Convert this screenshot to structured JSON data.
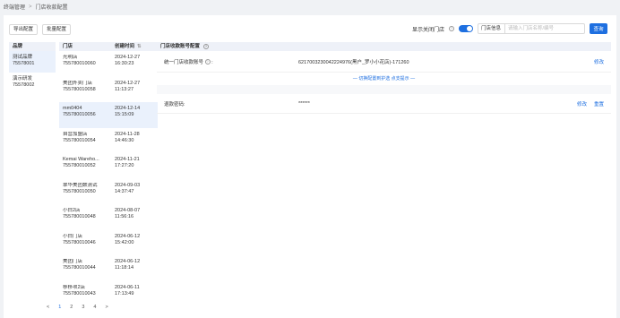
{
  "breadcrumb": {
    "root": "终端管理",
    "sep": ">",
    "current": "门店收款配置"
  },
  "toolbar": {
    "export": "导出配置",
    "batch": "批量配置"
  },
  "topright": {
    "show_closed": "显示关闭门店",
    "filter_select": "门店信息",
    "search_placeholder": "请输入门店名称/编号",
    "query": "查询"
  },
  "brands": {
    "header": "品牌",
    "items": [
      {
        "name": "测试品牌",
        "id": "75578001"
      },
      {
        "name": "演示研发",
        "id": "75578002"
      }
    ]
  },
  "stores": {
    "col_store": "门店",
    "col_created": "创建时间",
    "rows": [
      {
        "name": "光明店",
        "code": "755780010060",
        "date": "2024-12-27",
        "time": "16:30:23"
      },
      {
        "name": "美团外卖门店",
        "code": "755780010058",
        "date": "2024-12-27",
        "time": "11:13:27"
      },
      {
        "name": "mm0404",
        "code": "755780010056",
        "date": "2024-12-14",
        "time": "15:15:09"
      },
      {
        "name": "自营加盟店",
        "code": "755780010054",
        "date": "2024-11-28",
        "time": "14:46:30"
      },
      {
        "name": "Kemai Wareho...",
        "code": "755780010052",
        "date": "2024-11-21",
        "time": "17:27:20"
      },
      {
        "name": "翠华美团数测试",
        "code": "755780010050",
        "date": "2024-09-03",
        "time": "14:37:47"
      },
      {
        "name": "小白2店",
        "code": "755780010048",
        "date": "2024-08-07",
        "time": "11:56:16"
      },
      {
        "name": "小白门店",
        "code": "755780010046",
        "date": "2024-06-12",
        "time": "15:42:00"
      },
      {
        "name": "美团门店",
        "code": "755780010044",
        "date": "2024-06-12",
        "time": "11:18:14"
      },
      {
        "name": "移移项2店",
        "code": "755780010043",
        "date": "2024-06-11",
        "time": "17:13:49"
      }
    ]
  },
  "pager": {
    "prev": "<",
    "p1": "1",
    "p2": "2",
    "p3": "3",
    "p4": "4",
    "next": ">"
  },
  "detail": {
    "header": "门店收款账号配置",
    "account_label": "统一门店收款账号",
    "account_value": "621700323004222497​6(黑户_罗小小花店)-171260",
    "account_op": "修改",
    "links": "— 切换配置到护选   点支提示 —",
    "refund_label": "退款密码:",
    "refund_value": "******",
    "refund_edit": "修改",
    "refund_reset": "重置"
  }
}
